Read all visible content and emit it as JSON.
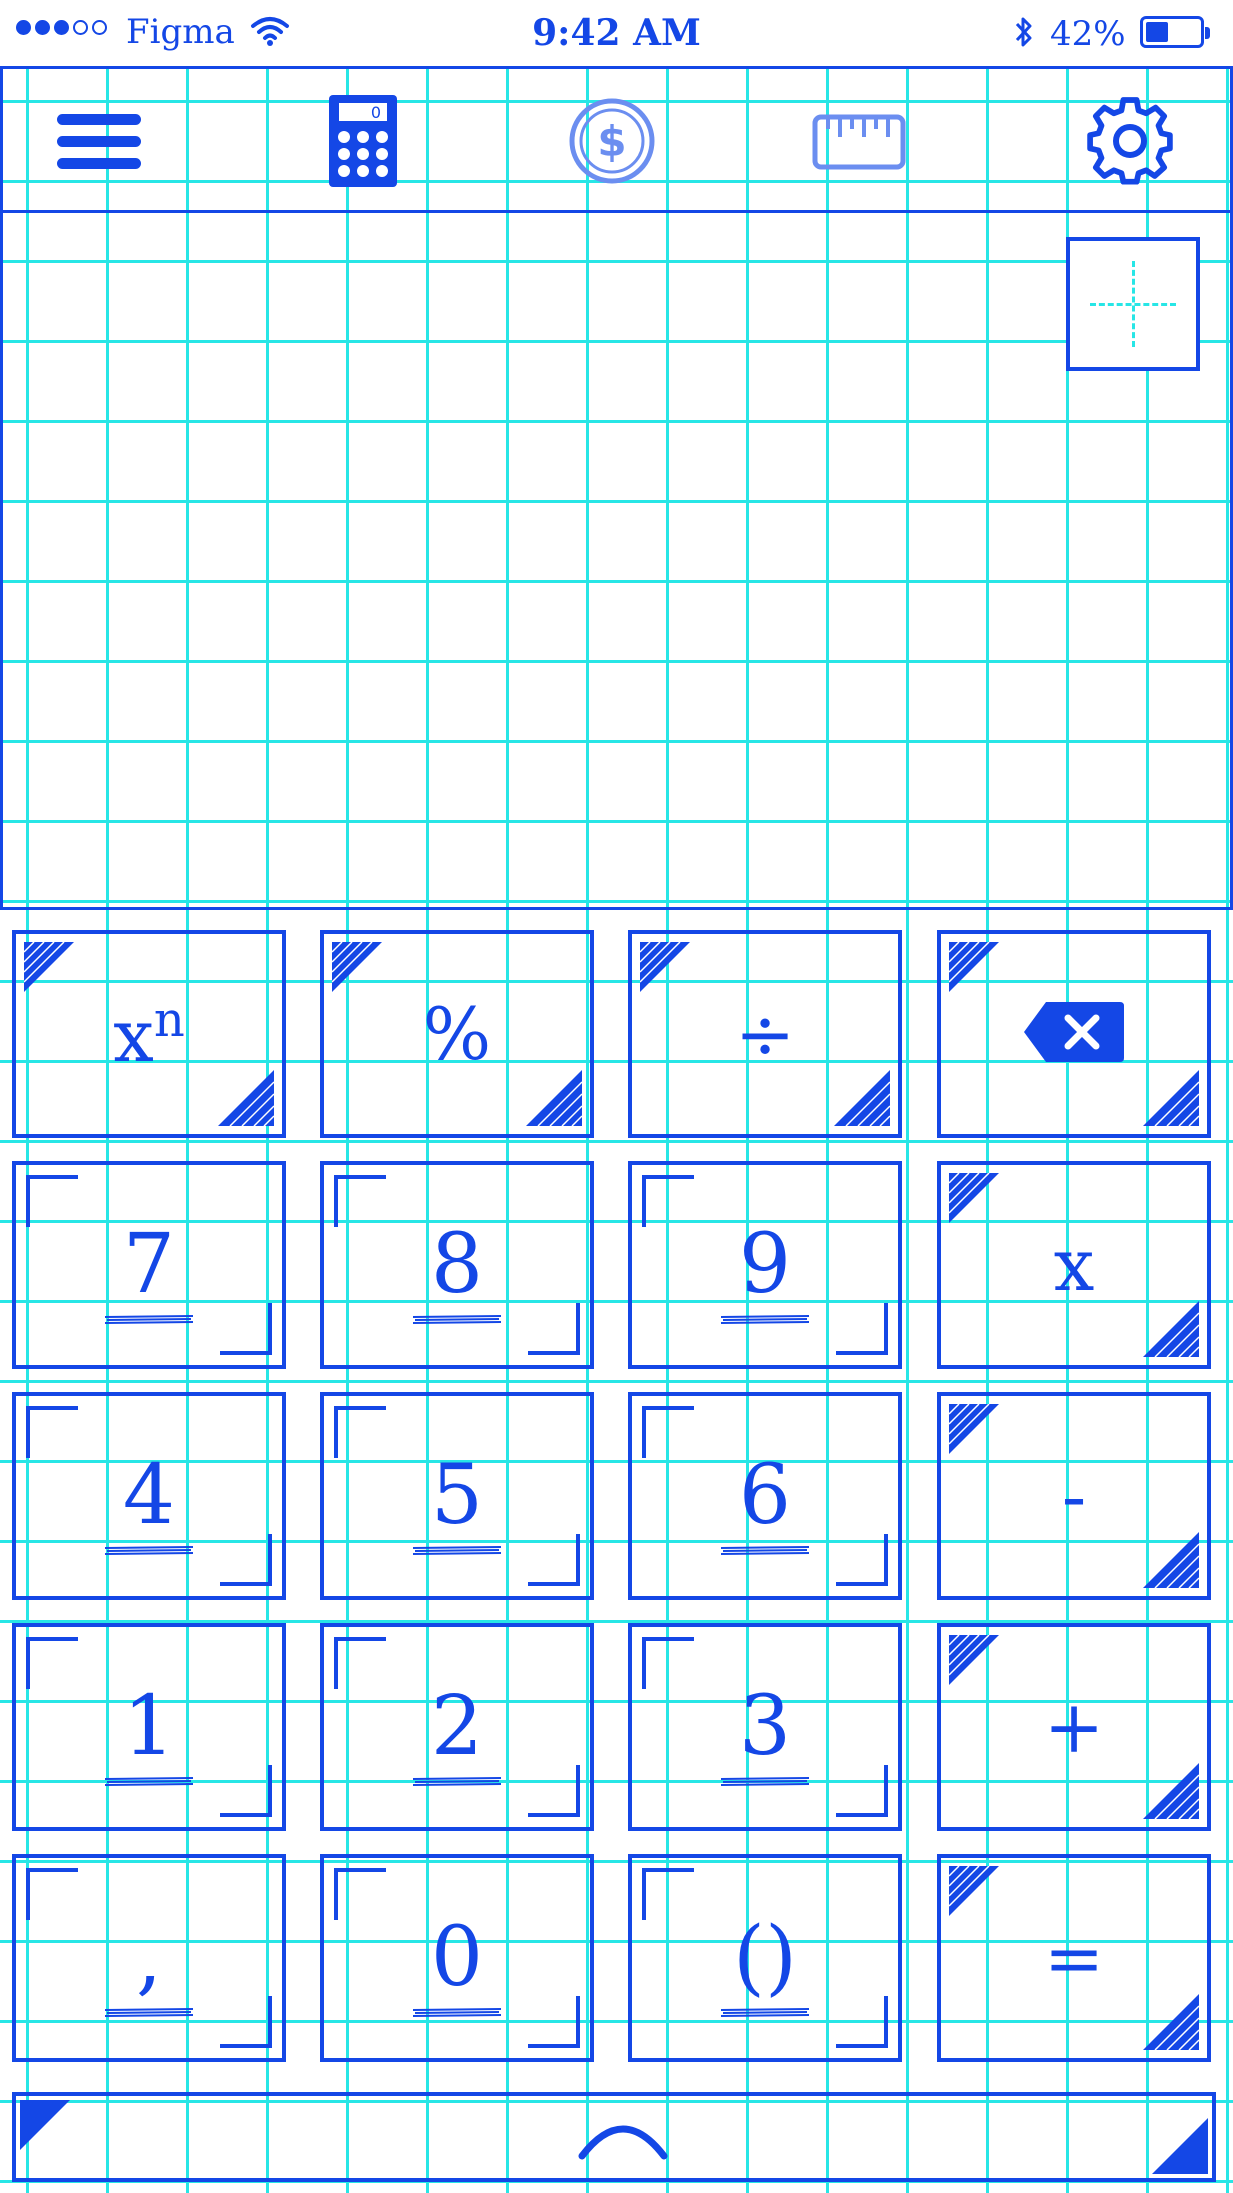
{
  "status_bar": {
    "carrier": "Figma",
    "time": "9:42 AM",
    "battery_percent": "42%",
    "battery_level": 0.42,
    "signal_bars_filled": 3,
    "signal_bars_total": 5
  },
  "toolbar": {
    "items": [
      {
        "id": "menu",
        "icon": "hamburger-menu-icon"
      },
      {
        "id": "calculator",
        "icon": "calculator-icon",
        "calc_display": "0"
      },
      {
        "id": "currency",
        "icon": "dollar-coin-icon",
        "glyph": "$"
      },
      {
        "id": "units",
        "icon": "ruler-icon"
      },
      {
        "id": "settings",
        "icon": "gear-icon"
      }
    ]
  },
  "display": {
    "value": ""
  },
  "keypad": {
    "rows": [
      [
        {
          "label": "x",
          "sup": "n",
          "type": "op",
          "name": "power"
        },
        {
          "label": "%",
          "type": "op",
          "name": "percent"
        },
        {
          "label": "÷",
          "type": "op",
          "name": "divide"
        },
        {
          "label": "",
          "type": "op",
          "name": "backspace",
          "icon": "backspace-icon"
        }
      ],
      [
        {
          "label": "7",
          "type": "num",
          "name": "7"
        },
        {
          "label": "8",
          "type": "num",
          "name": "8"
        },
        {
          "label": "9",
          "type": "num",
          "name": "9"
        },
        {
          "label": "x",
          "type": "op",
          "name": "multiply"
        }
      ],
      [
        {
          "label": "4",
          "type": "num",
          "name": "4"
        },
        {
          "label": "5",
          "type": "num",
          "name": "5"
        },
        {
          "label": "6",
          "type": "num",
          "name": "6"
        },
        {
          "label": "-",
          "type": "op",
          "name": "subtract"
        }
      ],
      [
        {
          "label": "1",
          "type": "num",
          "name": "1"
        },
        {
          "label": "2",
          "type": "num",
          "name": "2"
        },
        {
          "label": "3",
          "type": "num",
          "name": "3"
        },
        {
          "label": "+",
          "type": "op",
          "name": "add"
        }
      ],
      [
        {
          "label": ",",
          "type": "num",
          "name": "comma"
        },
        {
          "label": "0",
          "type": "num",
          "name": "0"
        },
        {
          "label": "()",
          "type": "num",
          "name": "parentheses"
        },
        {
          "label": "=",
          "type": "op",
          "name": "equals"
        }
      ]
    ]
  },
  "drawer": {
    "icon": "chevron-up-icon"
  },
  "colors": {
    "ink": "#1447e6",
    "grid": "#27e6e6",
    "paper": "#ffffff"
  }
}
